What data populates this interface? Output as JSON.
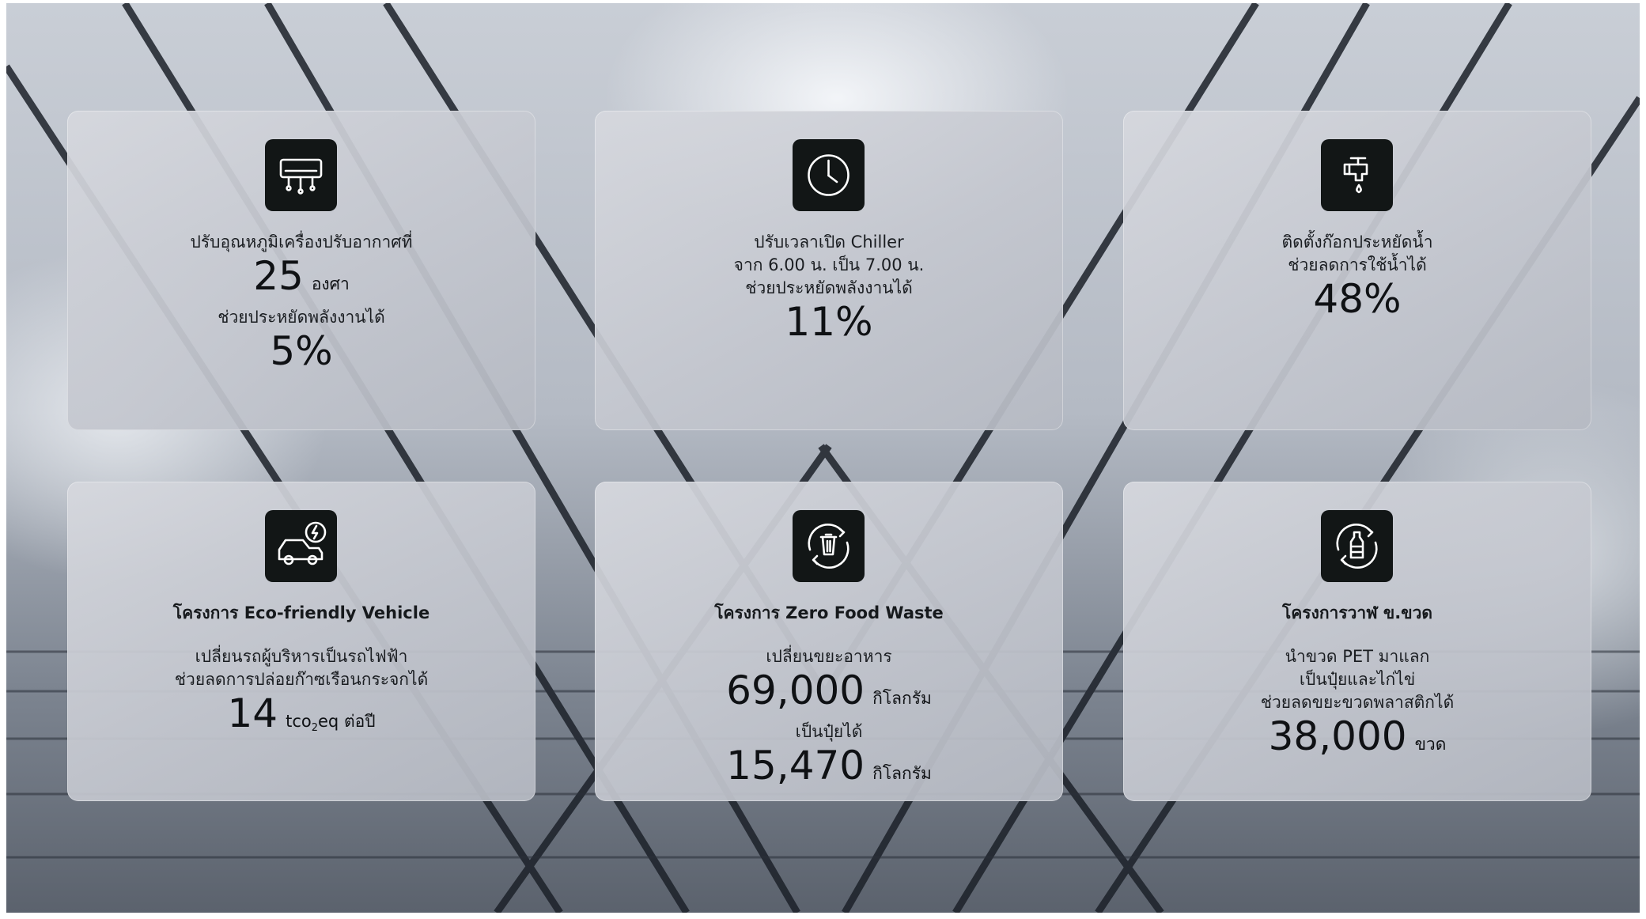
{
  "cards": [
    {
      "icon": "air-conditioner-icon",
      "line1": "ปรับอุณหภูมิเครื่องปรับอากาศที่",
      "num": "25",
      "num_unit": "องศา",
      "line2": "ช่วยประหยัดพลังงานได้",
      "pct": "5%"
    },
    {
      "icon": "clock-icon",
      "line1": "ปรับเวลาเปิด Chiller",
      "line2": "จาก 6.00 น. เป็น 7.00 น.",
      "line3": "ช่วยประหยัดพลังงานได้",
      "pct": "11%"
    },
    {
      "icon": "water-tap-icon",
      "line1": "ติดตั้งก๊อกประหยัดน้ำ",
      "line2": "ช่วยลดการใช้น้ำได้",
      "pct": "48%"
    },
    {
      "icon": "electric-car-icon",
      "title": "โครงการ Eco-friendly Vehicle",
      "line1": "เปลี่ยนรถผู้บริหารเป็นรถไฟฟ้า",
      "line2": "ช่วยลดการปล่อยก๊าซเรือนกระจกได้",
      "num": "14",
      "unit_pre": "tco",
      "unit_sub": "2",
      "unit_post": "eq ต่อปี"
    },
    {
      "icon": "recycle-bin-icon",
      "title": "โครงการ Zero Food Waste",
      "line1": "เปลี่ยนขยะอาหาร",
      "num1": "69,000",
      "unit1": "กิโลกรัม",
      "line2": "เป็นปุ๋ยได้",
      "num2": "15,470",
      "unit2": "กิโลกรัม"
    },
    {
      "icon": "bottle-recycle-icon",
      "title": "โครงการวาฬ ข.ขวด",
      "line1": "นำขวด PET มาแลก",
      "line2": "เป็นปุ๋ยและไก่ไข่",
      "line3": "ช่วยลดขยะขวดพลาสติกได้",
      "num": "38,000",
      "unit": "ขวด"
    }
  ]
}
